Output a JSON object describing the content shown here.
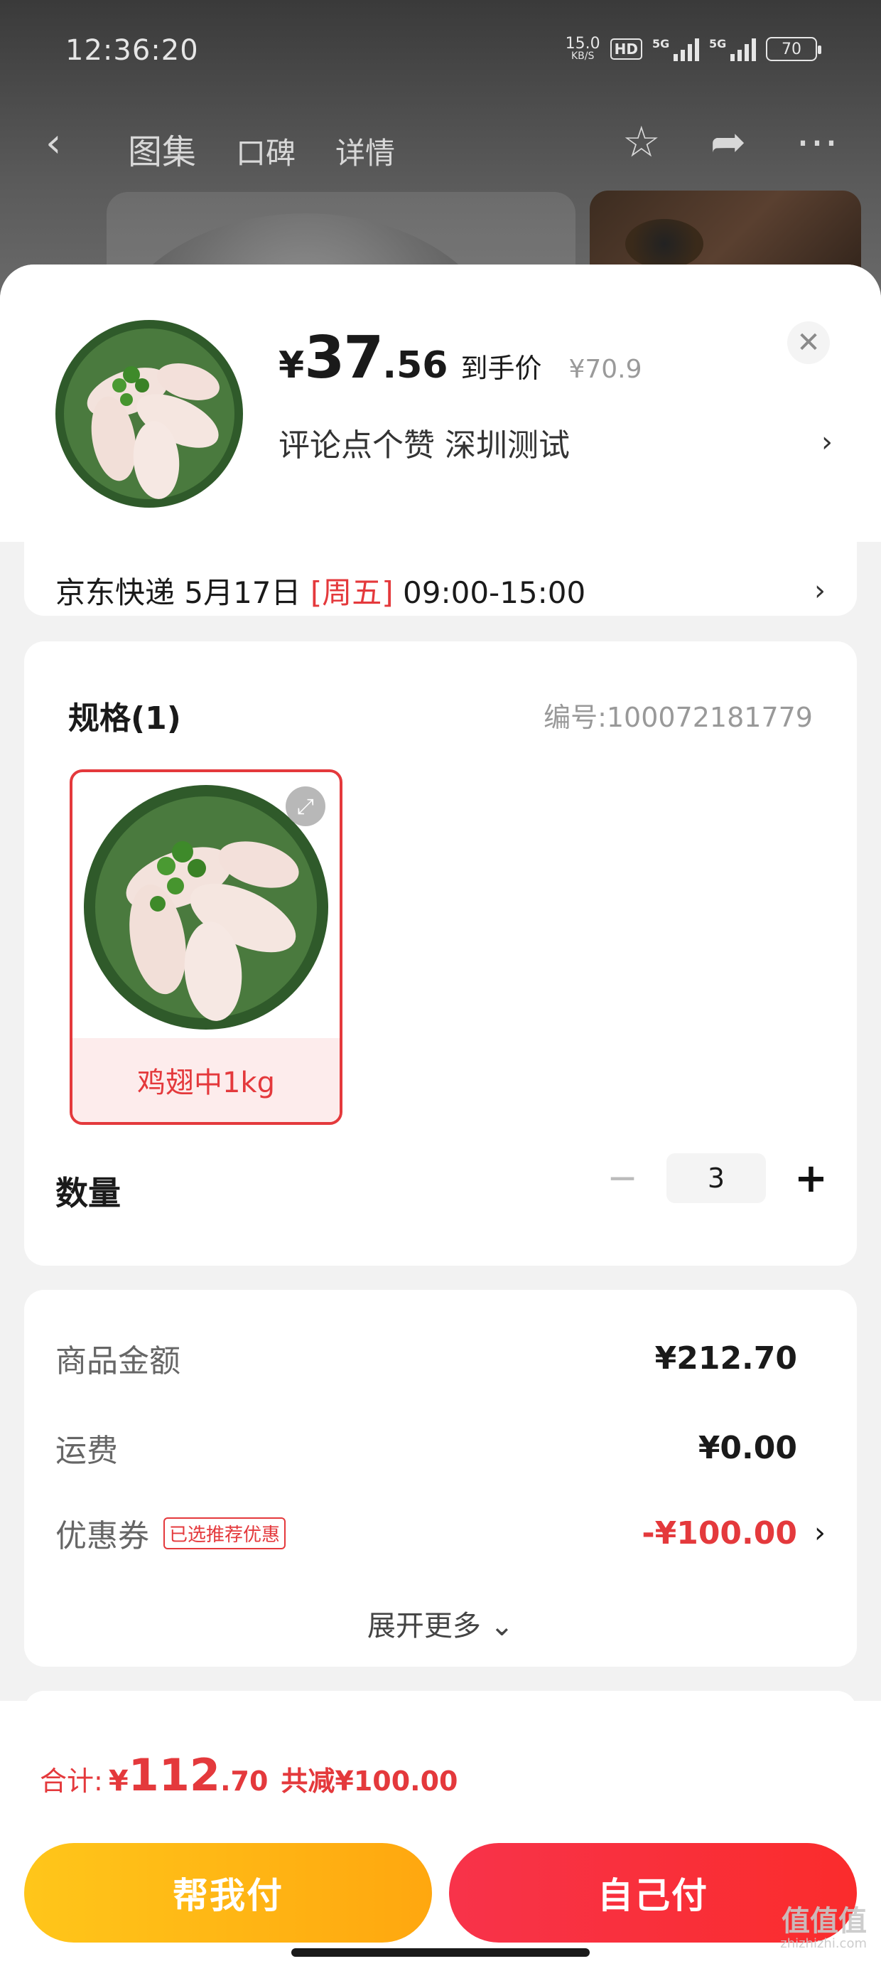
{
  "status_bar": {
    "time": "12:36:20",
    "net_speed": "15.0",
    "net_unit": "KB/S",
    "hd": "HD",
    "sig1_label": "5G",
    "sig2_label": "5G",
    "battery": "70"
  },
  "nav": {
    "tabs": [
      "图集",
      "口碑",
      "详情"
    ]
  },
  "header": {
    "currency": "¥",
    "price_int": "37",
    "price_dec": ".56",
    "price_label": "到手价",
    "original_price": "¥70.9",
    "address": "评论点个赞  深圳测试"
  },
  "delivery": {
    "prefix": "京东快递 5月17日 ",
    "weekday": "[周五]",
    "time": " 09:00-15:00"
  },
  "spec": {
    "title": "规格(1)",
    "code": "编号:100072181779",
    "option_label": "鸡翅中1kg"
  },
  "quantity": {
    "label": "数量",
    "value": "3"
  },
  "fees": {
    "goods_label": "商品金额",
    "goods_value": "¥212.70",
    "shipping_label": "运费",
    "shipping_value": "¥0.00",
    "coupon_label": "优惠券",
    "coupon_tag": "已选推荐优惠",
    "coupon_value": "-¥100.00",
    "more": "展开更多"
  },
  "footer": {
    "total_label": "合计:",
    "total_currency": "¥",
    "total_int": "112",
    "total_dec": ".70",
    "discount": "共减¥100.00",
    "help_pay": "帮我付",
    "self_pay": "自己付"
  },
  "watermark": {
    "text": "值值值",
    "sub": "zhizhizhi.com"
  },
  "colors": {
    "accent_red": "#e4393c",
    "help_yellow": "#ffb514",
    "self_red": "#f8334a"
  },
  "icons": {
    "back": "chevron-left-icon",
    "favorite": "star-icon",
    "share": "share-icon",
    "more": "more-dots-icon",
    "close": "close-icon",
    "arrow": "chevron-right-icon",
    "expand": "expand-icon",
    "minus": "minus-icon",
    "plus": "plus-icon",
    "down": "chevron-down-icon"
  }
}
